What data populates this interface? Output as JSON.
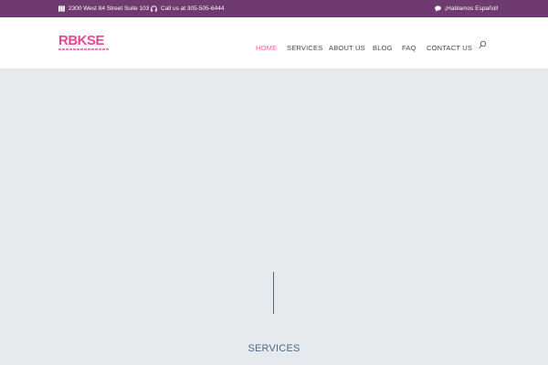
{
  "topbar": {
    "address": "2300 West 84 Street Suite 103",
    "phone": "Call us at 305-505-6444",
    "spanish": "¡Hablamos Español!",
    "address_icon": "map-icon",
    "phone_icon": "headphones-icon",
    "spanish_icon": "speech-bubble-icon"
  },
  "header": {
    "logo_text": "RBKSE",
    "nav": [
      {
        "label": "HOME",
        "active": true
      },
      {
        "label": "SERVICES",
        "active": false
      },
      {
        "label": "ABOUT US",
        "active": false
      },
      {
        "label": "BLOG",
        "active": false
      },
      {
        "label": "FAQ",
        "active": false
      },
      {
        "label": "CONTACT US",
        "active": false
      }
    ],
    "search_icon": "search-icon"
  },
  "main": {
    "section_title": "SERVICES"
  },
  "colors": {
    "topbar_bg": "#6f3a6f",
    "brand_pink": "#e8468f",
    "nav_active": "#e0689c",
    "hero_bg": "#e6eaed",
    "section_title": "#4a6b8e"
  }
}
